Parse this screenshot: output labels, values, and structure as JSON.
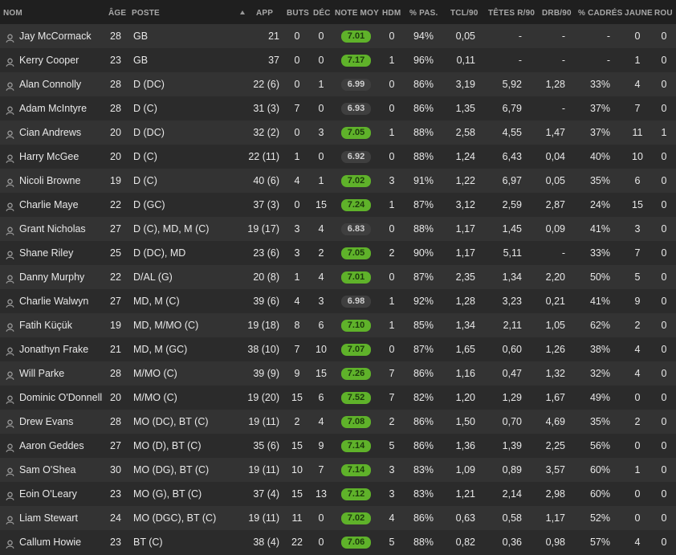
{
  "columns": {
    "nom": "NOM",
    "age": "ÂGE",
    "poste": "POSTE",
    "app": "APP",
    "buts": "BUTS",
    "dec": "DÉC",
    "note": "NOTE MOY",
    "hdm": "HDM",
    "pas": "% PAS.",
    "tcl": "TCL/90",
    "tetes": "TÊTES R/90",
    "drb": "DRB/90",
    "cadres": "% CADRÉS",
    "jaune": "JAUNE",
    "rouge": "ROU"
  },
  "icons": {
    "player": "person-icon",
    "sort": "sort-ascending-icon"
  },
  "colors": {
    "rating_good": "#5fb22a",
    "rating_avg": "#3f3f3f"
  },
  "players": [
    {
      "name": "Jay McCormack",
      "age": "28",
      "pos": "GB",
      "app": "21",
      "goals": "0",
      "assists": "0",
      "rating": "7.01",
      "good": true,
      "potm": "0",
      "pass": "94%",
      "tackles": "0,05",
      "headers": "-",
      "dribbles": "-",
      "shots": "-",
      "yellow": "0",
      "red": "0"
    },
    {
      "name": "Kerry Cooper",
      "age": "23",
      "pos": "GB",
      "app": "37",
      "goals": "0",
      "assists": "0",
      "rating": "7.17",
      "good": true,
      "potm": "1",
      "pass": "96%",
      "tackles": "0,11",
      "headers": "-",
      "dribbles": "-",
      "shots": "-",
      "yellow": "1",
      "red": "0"
    },
    {
      "name": "Alan Connolly",
      "age": "28",
      "pos": "D (DC)",
      "app": "22 (6)",
      "goals": "0",
      "assists": "1",
      "rating": "6.99",
      "good": false,
      "potm": "0",
      "pass": "86%",
      "tackles": "3,19",
      "headers": "5,92",
      "dribbles": "1,28",
      "shots": "33%",
      "yellow": "4",
      "red": "0"
    },
    {
      "name": "Adam McIntyre",
      "age": "28",
      "pos": "D (C)",
      "app": "31 (3)",
      "goals": "7",
      "assists": "0",
      "rating": "6.93",
      "good": false,
      "potm": "0",
      "pass": "86%",
      "tackles": "1,35",
      "headers": "6,79",
      "dribbles": "-",
      "shots": "37%",
      "yellow": "7",
      "red": "0"
    },
    {
      "name": "Cian Andrews",
      "age": "20",
      "pos": "D (DC)",
      "app": "32 (2)",
      "goals": "0",
      "assists": "3",
      "rating": "7.05",
      "good": true,
      "potm": "1",
      "pass": "88%",
      "tackles": "2,58",
      "headers": "4,55",
      "dribbles": "1,47",
      "shots": "37%",
      "yellow": "11",
      "red": "1"
    },
    {
      "name": "Harry McGee",
      "age": "20",
      "pos": "D (C)",
      "app": "22 (11)",
      "goals": "1",
      "assists": "0",
      "rating": "6.92",
      "good": false,
      "potm": "0",
      "pass": "88%",
      "tackles": "1,24",
      "headers": "6,43",
      "dribbles": "0,04",
      "shots": "40%",
      "yellow": "10",
      "red": "0"
    },
    {
      "name": "Nicoli Browne",
      "age": "19",
      "pos": "D (C)",
      "app": "40 (6)",
      "goals": "4",
      "assists": "1",
      "rating": "7.02",
      "good": true,
      "potm": "3",
      "pass": "91%",
      "tackles": "1,22",
      "headers": "6,97",
      "dribbles": "0,05",
      "shots": "35%",
      "yellow": "6",
      "red": "0"
    },
    {
      "name": "Charlie Maye",
      "age": "22",
      "pos": "D (GC)",
      "app": "37 (3)",
      "goals": "0",
      "assists": "15",
      "rating": "7.24",
      "good": true,
      "potm": "1",
      "pass": "87%",
      "tackles": "3,12",
      "headers": "2,59",
      "dribbles": "2,87",
      "shots": "24%",
      "yellow": "15",
      "red": "0"
    },
    {
      "name": "Grant Nicholas",
      "age": "27",
      "pos": "D (C), MD, M (C)",
      "app": "19 (17)",
      "goals": "3",
      "assists": "4",
      "rating": "6.83",
      "good": false,
      "potm": "0",
      "pass": "88%",
      "tackles": "1,17",
      "headers": "1,45",
      "dribbles": "0,09",
      "shots": "41%",
      "yellow": "3",
      "red": "0"
    },
    {
      "name": "Shane Riley",
      "age": "25",
      "pos": "D (DC), MD",
      "app": "23 (6)",
      "goals": "3",
      "assists": "2",
      "rating": "7.05",
      "good": true,
      "potm": "2",
      "pass": "90%",
      "tackles": "1,17",
      "headers": "5,11",
      "dribbles": "-",
      "shots": "33%",
      "yellow": "7",
      "red": "0"
    },
    {
      "name": "Danny Murphy",
      "age": "22",
      "pos": "D/AL (G)",
      "app": "20 (8)",
      "goals": "1",
      "assists": "4",
      "rating": "7.01",
      "good": true,
      "potm": "0",
      "pass": "87%",
      "tackles": "2,35",
      "headers": "1,34",
      "dribbles": "2,20",
      "shots": "50%",
      "yellow": "5",
      "red": "0"
    },
    {
      "name": "Charlie Walwyn",
      "age": "27",
      "pos": "MD, M (C)",
      "app": "39 (6)",
      "goals": "4",
      "assists": "3",
      "rating": "6.98",
      "good": false,
      "potm": "1",
      "pass": "92%",
      "tackles": "1,28",
      "headers": "3,23",
      "dribbles": "0,21",
      "shots": "41%",
      "yellow": "9",
      "red": "0"
    },
    {
      "name": "Fatih Küçük",
      "age": "19",
      "pos": "MD, M/MO (C)",
      "app": "19 (18)",
      "goals": "8",
      "assists": "6",
      "rating": "7.10",
      "good": true,
      "potm": "1",
      "pass": "85%",
      "tackles": "1,34",
      "headers": "2,11",
      "dribbles": "1,05",
      "shots": "62%",
      "yellow": "2",
      "red": "0"
    },
    {
      "name": "Jonathyn Frake",
      "age": "21",
      "pos": "MD, M (GC)",
      "app": "38 (10)",
      "goals": "7",
      "assists": "10",
      "rating": "7.07",
      "good": true,
      "potm": "0",
      "pass": "87%",
      "tackles": "1,65",
      "headers": "0,60",
      "dribbles": "1,26",
      "shots": "38%",
      "yellow": "4",
      "red": "0"
    },
    {
      "name": "Will Parke",
      "age": "28",
      "pos": "M/MO (C)",
      "app": "39 (9)",
      "goals": "9",
      "assists": "15",
      "rating": "7.26",
      "good": true,
      "potm": "7",
      "pass": "86%",
      "tackles": "1,16",
      "headers": "0,47",
      "dribbles": "1,32",
      "shots": "32%",
      "yellow": "4",
      "red": "0"
    },
    {
      "name": "Dominic O'Donnell",
      "age": "20",
      "pos": "M/MO (C)",
      "app": "19 (20)",
      "goals": "15",
      "assists": "6",
      "rating": "7.52",
      "good": true,
      "potm": "7",
      "pass": "82%",
      "tackles": "1,20",
      "headers": "1,29",
      "dribbles": "1,67",
      "shots": "49%",
      "yellow": "0",
      "red": "0"
    },
    {
      "name": "Drew Evans",
      "age": "28",
      "pos": "MO (DC), BT (C)",
      "app": "19 (11)",
      "goals": "2",
      "assists": "4",
      "rating": "7.08",
      "good": true,
      "potm": "2",
      "pass": "86%",
      "tackles": "1,50",
      "headers": "0,70",
      "dribbles": "4,69",
      "shots": "35%",
      "yellow": "2",
      "red": "0"
    },
    {
      "name": "Aaron Geddes",
      "age": "27",
      "pos": "MO (D), BT (C)",
      "app": "35 (6)",
      "goals": "15",
      "assists": "9",
      "rating": "7.14",
      "good": true,
      "potm": "5",
      "pass": "86%",
      "tackles": "1,36",
      "headers": "1,39",
      "dribbles": "2,25",
      "shots": "56%",
      "yellow": "0",
      "red": "0"
    },
    {
      "name": "Sam O'Shea",
      "age": "30",
      "pos": "MO (DG), BT (C)",
      "app": "19 (11)",
      "goals": "10",
      "assists": "7",
      "rating": "7.14",
      "good": true,
      "potm": "3",
      "pass": "83%",
      "tackles": "1,09",
      "headers": "0,89",
      "dribbles": "3,57",
      "shots": "60%",
      "yellow": "1",
      "red": "0"
    },
    {
      "name": "Eoin O'Leary",
      "age": "23",
      "pos": "MO (G), BT (C)",
      "app": "37 (4)",
      "goals": "15",
      "assists": "13",
      "rating": "7.12",
      "good": true,
      "potm": "3",
      "pass": "83%",
      "tackles": "1,21",
      "headers": "2,14",
      "dribbles": "2,98",
      "shots": "60%",
      "yellow": "0",
      "red": "0"
    },
    {
      "name": "Liam Stewart",
      "age": "24",
      "pos": "MO (DGC), BT (C)",
      "app": "19 (11)",
      "goals": "11",
      "assists": "0",
      "rating": "7.02",
      "good": true,
      "potm": "4",
      "pass": "86%",
      "tackles": "0,63",
      "headers": "0,58",
      "dribbles": "1,17",
      "shots": "52%",
      "yellow": "0",
      "red": "0"
    },
    {
      "name": "Callum Howie",
      "age": "23",
      "pos": "BT (C)",
      "app": "38 (4)",
      "goals": "22",
      "assists": "0",
      "rating": "7.06",
      "good": true,
      "potm": "5",
      "pass": "88%",
      "tackles": "0,82",
      "headers": "0,36",
      "dribbles": "0,98",
      "shots": "57%",
      "yellow": "4",
      "red": "0"
    }
  ]
}
